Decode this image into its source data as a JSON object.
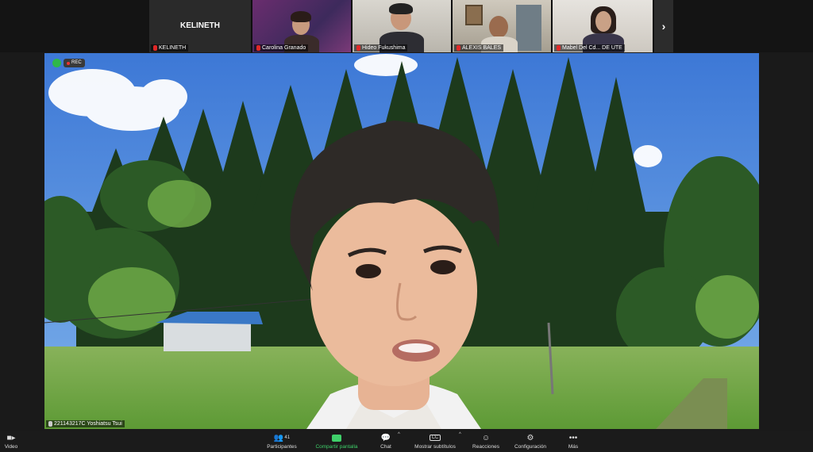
{
  "participants": [
    {
      "name": "KELINETH",
      "display": "KELINETH",
      "has_video": false
    },
    {
      "name": "Carolina Granado",
      "has_video": true
    },
    {
      "name": "Hideo Fukushima",
      "has_video": true
    },
    {
      "name": "ALEXIS BALES",
      "has_video": true
    },
    {
      "name": "Mabel Del Cd... DE UTE",
      "has_video": true
    }
  ],
  "strip": {
    "next_icon": "›"
  },
  "main_video": {
    "speaker_name": "221143217C Yoshiatsu Tsui",
    "rec_label": "REC"
  },
  "toolbar": {
    "video_label": "Video",
    "participants_count": "41",
    "participants_label": "Participantes",
    "share_label": "Compartir pantalla",
    "chat_label": "Chat",
    "subtitles_label": "Mostrar subtítulos",
    "reactions_label": "Reacciones",
    "settings_label": "Configuración",
    "more_label": "Más"
  },
  "colors": {
    "share_green": "#3fd06a",
    "mic_off_red": "#e02828"
  }
}
